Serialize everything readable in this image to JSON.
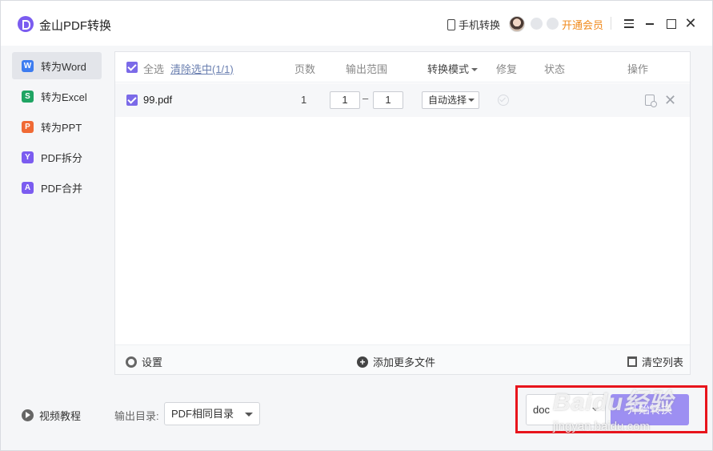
{
  "app": {
    "title": "金山PDF转换"
  },
  "header": {
    "phone_convert": "手机转换",
    "vip": "开通会员"
  },
  "sidebar": {
    "items": [
      {
        "label": "转为Word",
        "icon": "W",
        "color": "#3d7cf0",
        "active": true
      },
      {
        "label": "转为Excel",
        "icon": "S",
        "color": "#1fa463",
        "active": false
      },
      {
        "label": "转为PPT",
        "icon": "P",
        "color": "#f06a35",
        "active": false
      },
      {
        "label": "PDF拆分",
        "icon": "Y",
        "color": "#7b5cf0",
        "active": false
      },
      {
        "label": "PDF合并",
        "icon": "A",
        "color": "#7b5cf0",
        "active": false
      }
    ]
  },
  "table": {
    "select_all": "全选",
    "clear_selection": "清除选中(1/1)",
    "columns": {
      "pages": "页数",
      "range": "输出范围",
      "mode": "转换模式",
      "repair": "修复",
      "status": "状态",
      "actions": "操作"
    },
    "rows": [
      {
        "filename": "99.pdf",
        "pages": "1",
        "range_from": "1",
        "range_sep": "–",
        "range_to": "1",
        "mode": "自动选择"
      }
    ]
  },
  "panel_footer": {
    "settings": "设置",
    "add_files": "添加更多文件",
    "clear_list": "清空列表"
  },
  "bottom": {
    "tutorial": "视频教程",
    "output_dir_label": "输出目录:",
    "output_dir_value": "PDF相同目录",
    "format_value": "doc",
    "start_button": "开始转换"
  },
  "watermark": {
    "main": "Baidu经验",
    "sub": "jingyan.baidu.com"
  }
}
